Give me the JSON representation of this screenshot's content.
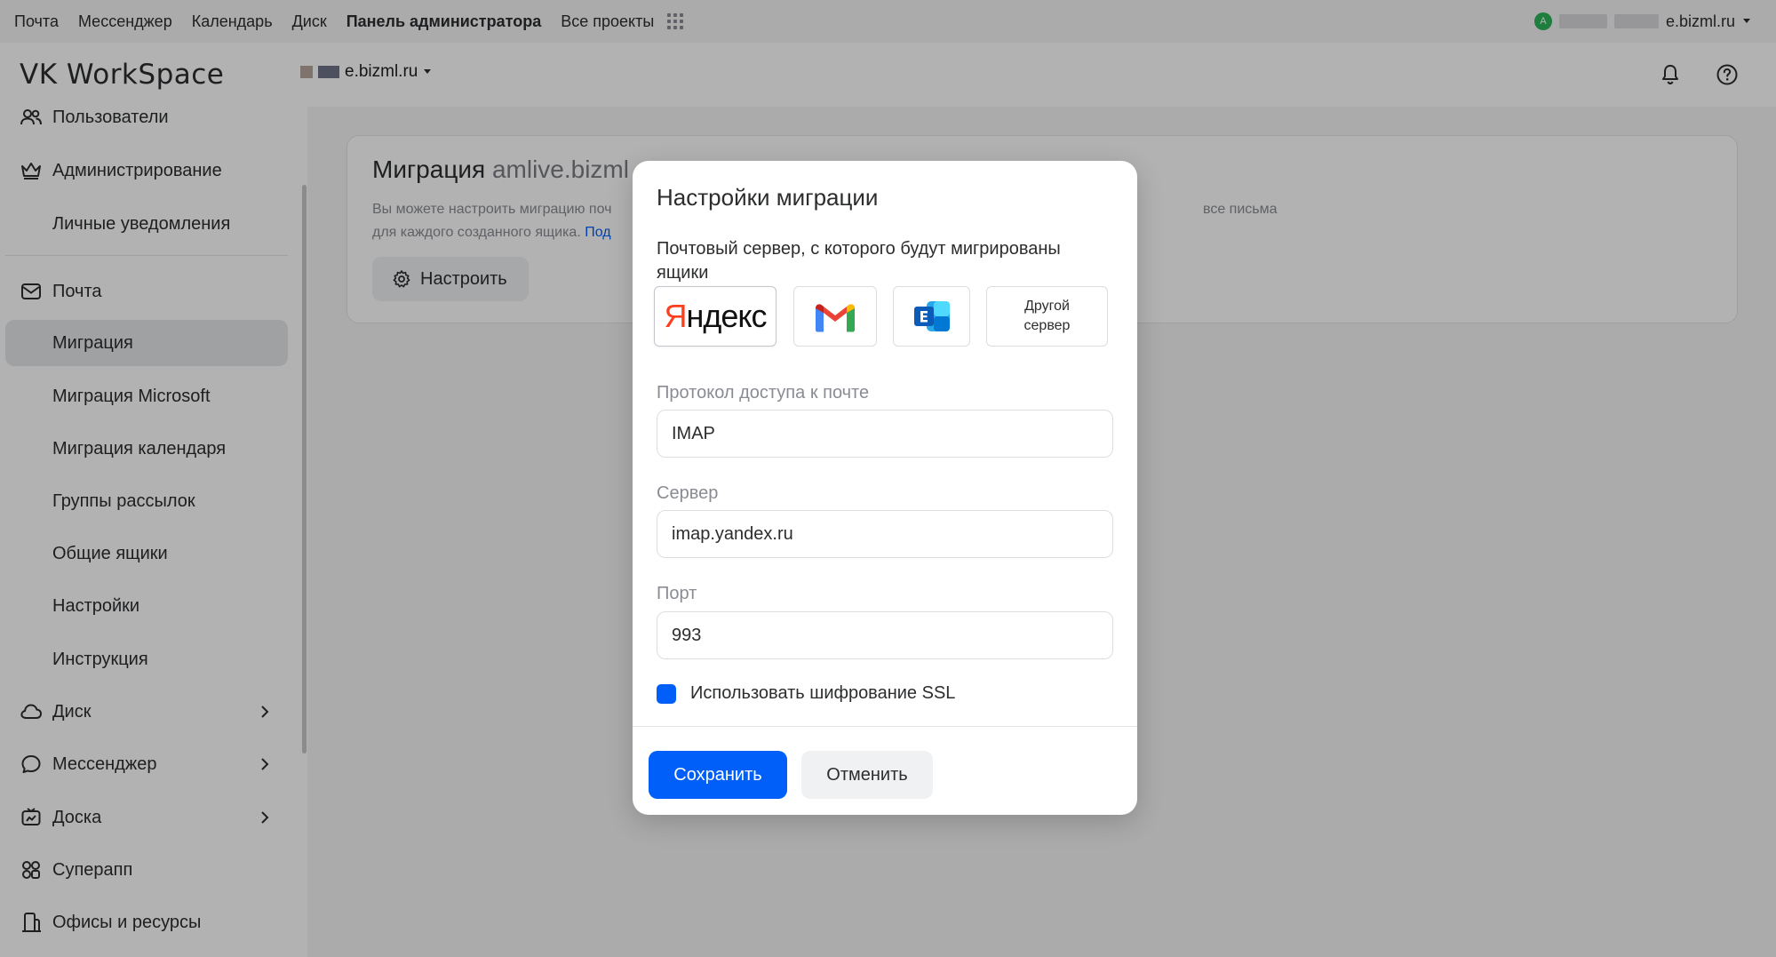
{
  "topbar": {
    "links": [
      "Почта",
      "Мессенджер",
      "Календарь",
      "Диск",
      "Панель администратора",
      "Все проекты"
    ],
    "active_link": "Панель администратора",
    "account_domain": "e.bizml.ru",
    "avatar_letter": "A"
  },
  "header": {
    "logo": "VK WorkSpace",
    "domain": "e.bizml.ru"
  },
  "sidebar": {
    "items": [
      {
        "label": "Пользователи",
        "icon": "users-icon"
      },
      {
        "label": "Администрирование",
        "icon": "crown-icon"
      },
      {
        "label": "Личные уведомления",
        "icon": ""
      },
      {
        "label": "Почта",
        "icon": "mail-icon"
      },
      {
        "label": "Миграция",
        "icon": "",
        "active": true
      },
      {
        "label": "Миграция Microsoft",
        "icon": ""
      },
      {
        "label": "Миграция календаря",
        "icon": ""
      },
      {
        "label": "Группы рассылок",
        "icon": ""
      },
      {
        "label": "Общие ящики",
        "icon": ""
      },
      {
        "label": "Настройки",
        "icon": ""
      },
      {
        "label": "Инструкция",
        "icon": ""
      },
      {
        "label": "Диск",
        "icon": "cloud-icon",
        "expandable": true
      },
      {
        "label": "Мессенджер",
        "icon": "chat-icon",
        "expandable": true
      },
      {
        "label": "Доска",
        "icon": "board-icon",
        "expandable": true
      },
      {
        "label": "Суперапп",
        "icon": "apps-icon"
      },
      {
        "label": "Офисы и ресурсы",
        "icon": "office-icon"
      }
    ]
  },
  "card": {
    "title": "Миграция",
    "title_domain": "amlive.bizml",
    "desc_line1": "Вы можете настроить миграцию поч",
    "desc_line2": "для каждого созданного ящика.",
    "desc_link": "Под",
    "desc_tail": "все письма",
    "button": "Настроить"
  },
  "modal": {
    "title": "Настройки миграции",
    "subtitle": "Почтовый сервер, с которого будут мигрированы ящики",
    "providers": {
      "yandex": "Яндекс",
      "other": "Другой сервер"
    },
    "protocol_label": "Протокол доступа к почте",
    "protocol_value": "IMAP",
    "server_label": "Сервер",
    "server_value": "imap.yandex.ru",
    "port_label": "Порт",
    "port_value": "993",
    "ssl_label": "Использовать шифрование SSL",
    "ssl_checked": true,
    "save": "Сохранить",
    "cancel": "Отменить"
  },
  "colors": {
    "accent": "#005ff9",
    "yandex_red": "#fc3f1d"
  }
}
